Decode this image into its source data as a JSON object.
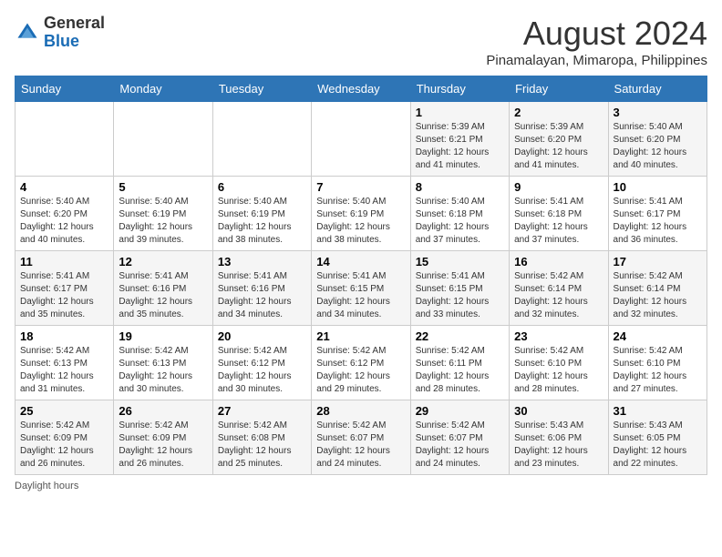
{
  "header": {
    "logo_line1": "General",
    "logo_line2": "Blue",
    "title": "August 2024",
    "subtitle": "Pinamalayan, Mimaropa, Philippines"
  },
  "weekdays": [
    "Sunday",
    "Monday",
    "Tuesday",
    "Wednesday",
    "Thursday",
    "Friday",
    "Saturday"
  ],
  "weeks": [
    [
      {
        "day": "",
        "info": ""
      },
      {
        "day": "",
        "info": ""
      },
      {
        "day": "",
        "info": ""
      },
      {
        "day": "",
        "info": ""
      },
      {
        "day": "1",
        "info": "Sunrise: 5:39 AM\nSunset: 6:21 PM\nDaylight: 12 hours and 41 minutes."
      },
      {
        "day": "2",
        "info": "Sunrise: 5:39 AM\nSunset: 6:20 PM\nDaylight: 12 hours and 41 minutes."
      },
      {
        "day": "3",
        "info": "Sunrise: 5:40 AM\nSunset: 6:20 PM\nDaylight: 12 hours and 40 minutes."
      }
    ],
    [
      {
        "day": "4",
        "info": "Sunrise: 5:40 AM\nSunset: 6:20 PM\nDaylight: 12 hours and 40 minutes."
      },
      {
        "day": "5",
        "info": "Sunrise: 5:40 AM\nSunset: 6:19 PM\nDaylight: 12 hours and 39 minutes."
      },
      {
        "day": "6",
        "info": "Sunrise: 5:40 AM\nSunset: 6:19 PM\nDaylight: 12 hours and 38 minutes."
      },
      {
        "day": "7",
        "info": "Sunrise: 5:40 AM\nSunset: 6:19 PM\nDaylight: 12 hours and 38 minutes."
      },
      {
        "day": "8",
        "info": "Sunrise: 5:40 AM\nSunset: 6:18 PM\nDaylight: 12 hours and 37 minutes."
      },
      {
        "day": "9",
        "info": "Sunrise: 5:41 AM\nSunset: 6:18 PM\nDaylight: 12 hours and 37 minutes."
      },
      {
        "day": "10",
        "info": "Sunrise: 5:41 AM\nSunset: 6:17 PM\nDaylight: 12 hours and 36 minutes."
      }
    ],
    [
      {
        "day": "11",
        "info": "Sunrise: 5:41 AM\nSunset: 6:17 PM\nDaylight: 12 hours and 35 minutes."
      },
      {
        "day": "12",
        "info": "Sunrise: 5:41 AM\nSunset: 6:16 PM\nDaylight: 12 hours and 35 minutes."
      },
      {
        "day": "13",
        "info": "Sunrise: 5:41 AM\nSunset: 6:16 PM\nDaylight: 12 hours and 34 minutes."
      },
      {
        "day": "14",
        "info": "Sunrise: 5:41 AM\nSunset: 6:15 PM\nDaylight: 12 hours and 34 minutes."
      },
      {
        "day": "15",
        "info": "Sunrise: 5:41 AM\nSunset: 6:15 PM\nDaylight: 12 hours and 33 minutes."
      },
      {
        "day": "16",
        "info": "Sunrise: 5:42 AM\nSunset: 6:14 PM\nDaylight: 12 hours and 32 minutes."
      },
      {
        "day": "17",
        "info": "Sunrise: 5:42 AM\nSunset: 6:14 PM\nDaylight: 12 hours and 32 minutes."
      }
    ],
    [
      {
        "day": "18",
        "info": "Sunrise: 5:42 AM\nSunset: 6:13 PM\nDaylight: 12 hours and 31 minutes."
      },
      {
        "day": "19",
        "info": "Sunrise: 5:42 AM\nSunset: 6:13 PM\nDaylight: 12 hours and 30 minutes."
      },
      {
        "day": "20",
        "info": "Sunrise: 5:42 AM\nSunset: 6:12 PM\nDaylight: 12 hours and 30 minutes."
      },
      {
        "day": "21",
        "info": "Sunrise: 5:42 AM\nSunset: 6:12 PM\nDaylight: 12 hours and 29 minutes."
      },
      {
        "day": "22",
        "info": "Sunrise: 5:42 AM\nSunset: 6:11 PM\nDaylight: 12 hours and 28 minutes."
      },
      {
        "day": "23",
        "info": "Sunrise: 5:42 AM\nSunset: 6:10 PM\nDaylight: 12 hours and 28 minutes."
      },
      {
        "day": "24",
        "info": "Sunrise: 5:42 AM\nSunset: 6:10 PM\nDaylight: 12 hours and 27 minutes."
      }
    ],
    [
      {
        "day": "25",
        "info": "Sunrise: 5:42 AM\nSunset: 6:09 PM\nDaylight: 12 hours and 26 minutes."
      },
      {
        "day": "26",
        "info": "Sunrise: 5:42 AM\nSunset: 6:09 PM\nDaylight: 12 hours and 26 minutes."
      },
      {
        "day": "27",
        "info": "Sunrise: 5:42 AM\nSunset: 6:08 PM\nDaylight: 12 hours and 25 minutes."
      },
      {
        "day": "28",
        "info": "Sunrise: 5:42 AM\nSunset: 6:07 PM\nDaylight: 12 hours and 24 minutes."
      },
      {
        "day": "29",
        "info": "Sunrise: 5:42 AM\nSunset: 6:07 PM\nDaylight: 12 hours and 24 minutes."
      },
      {
        "day": "30",
        "info": "Sunrise: 5:43 AM\nSunset: 6:06 PM\nDaylight: 12 hours and 23 minutes."
      },
      {
        "day": "31",
        "info": "Sunrise: 5:43 AM\nSunset: 6:05 PM\nDaylight: 12 hours and 22 minutes."
      }
    ]
  ],
  "footer": "Daylight hours"
}
